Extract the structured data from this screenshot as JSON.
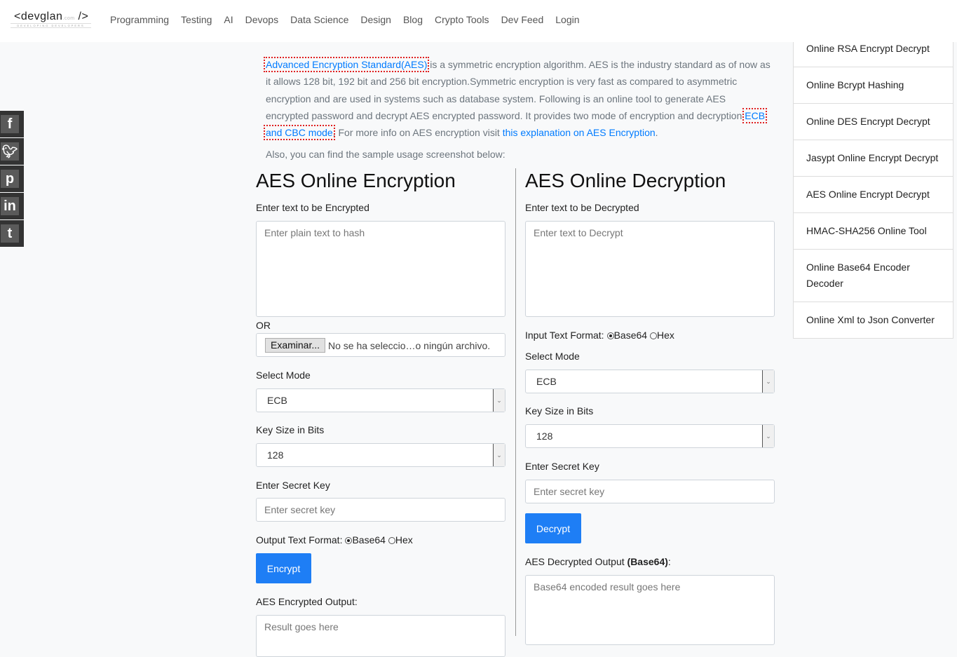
{
  "nav": {
    "logo": "<devglan",
    "logo_com": ".com",
    "logo_close": "/>",
    "logo_tag": "DEVELOPING DEVELOPERS",
    "items": [
      "Programming",
      "Testing",
      "AI",
      "Devops",
      "Data Science",
      "Design",
      "Blog",
      "Crypto Tools",
      "Dev Feed",
      "Login"
    ]
  },
  "intro": {
    "link1": "Advanced Encryption Standard(AES)",
    "t1": " is a symmetric encryption algorithm. AES is the industry standard as of now as it allows 128 bit, 192 bit and 256 bit encryption.Symmetric encryption is very fast as compared to asymmetric encryption and are used in systems such as database system. Following is an online tool to generate AES encrypted password and decrypt AES encrypted password. It provides two mode of encryption and decryption ",
    "link2": "ECB and CBC mode",
    "t2": ". For more info on AES encryption visit ",
    "link3": "this explanation on AES Encryption",
    "t3": ".",
    "also": "Also, you can find the sample usage screenshot below:"
  },
  "social": [
    "f",
    "t",
    "p",
    "in",
    "t"
  ],
  "enc": {
    "title": "AES Online Encryption",
    "text_label": "Enter text to be Encrypted",
    "text_placeholder": "Enter plain text to hash",
    "or": "OR",
    "file_button": "Examinar...",
    "file_status": "No se ha seleccio…o ningún archivo.",
    "mode_label": "Select Mode",
    "mode": "ECB",
    "key_size_label": "Key Size in Bits",
    "key_size": "128",
    "secret_label": "Enter Secret Key",
    "secret_placeholder": "Enter secret key",
    "format_label": "Output Text Format:",
    "format_opt1": "Base64",
    "format_opt2": "Hex",
    "format_selected": "Base64",
    "button": "Encrypt",
    "output_label": "AES Encrypted Output:",
    "output_placeholder": "Result goes here"
  },
  "dec": {
    "title": "AES Online Decryption",
    "text_label": "Enter text to be Decrypted",
    "text_placeholder": "Enter text to Decrypt",
    "format_label": "Input Text Format:",
    "format_opt1": "Base64",
    "format_opt2": "Hex",
    "format_selected": "Base64",
    "mode_label": "Select Mode",
    "mode": "ECB",
    "key_size_label": "Key Size in Bits",
    "key_size": "128",
    "secret_label": "Enter Secret Key",
    "secret_placeholder": "Enter secret key",
    "button": "Decrypt",
    "output_label": "AES Decrypted Output ",
    "output_label_bold": "(Base64)",
    "output_label_end": ":",
    "output_placeholder": "Base64 encoded result goes here"
  },
  "sidebar": [
    "Online RSA Encrypt Decrypt",
    "Online Bcrypt Hashing",
    "Online DES Encrypt Decrypt",
    "Jasypt Online Encrypt Decrypt",
    "AES Online Encrypt Decrypt",
    "HMAC-SHA256 Online Tool",
    "Online Base64 Encoder Decoder",
    "Online Xml to Json Converter"
  ]
}
